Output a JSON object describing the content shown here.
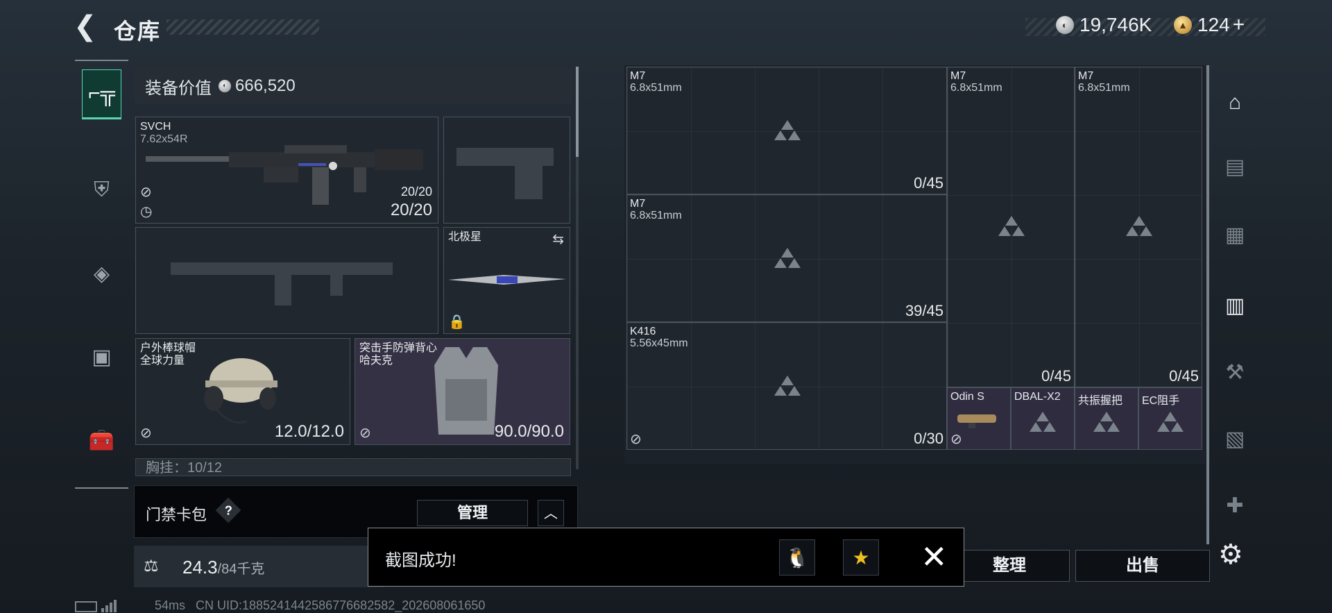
{
  "header": {
    "title": "仓库"
  },
  "currency": {
    "silver": "19,746K",
    "gold": "124"
  },
  "equipment_value": {
    "label": "装备价值",
    "value": "666,520"
  },
  "weapon_primary": {
    "name": "SVCH",
    "caliber": "7.62x54R",
    "mag": "20/20",
    "ammo": "20/20"
  },
  "melee": {
    "name": "北极星"
  },
  "helmet": {
    "name": "户外棒球帽",
    "sub": "全球力量",
    "durability": "12.0/12.0"
  },
  "armor": {
    "name": "突击手防弹背心",
    "sub": "哈夫克",
    "durability": "90.0/90.0"
  },
  "chest_rig": {
    "label": "胸挂：10/12"
  },
  "keycard": {
    "label": "门禁卡包",
    "help": "?",
    "manage": "管理"
  },
  "weight": {
    "value": "24.3",
    "max": "/84千克"
  },
  "status": {
    "ping": "54ms",
    "uid": "CN UID:1885241442586776682582_202608061650"
  },
  "magazines": [
    {
      "name": "M7",
      "caliber": "6.8x51mm",
      "count": "0/45"
    },
    {
      "name": "M7",
      "caliber": "6.8x51mm",
      "count": "39/45"
    },
    {
      "name": "K416",
      "caliber": "5.56x45mm",
      "count": "0/30"
    },
    {
      "name": "M7",
      "caliber": "6.8x51mm",
      "count": "0/45"
    },
    {
      "name": "M7",
      "caliber": "6.8x51mm",
      "count": "0/45"
    }
  ],
  "attachments": [
    {
      "name": "Odin S"
    },
    {
      "name": "DBAL-X2"
    },
    {
      "name": "共振握把"
    },
    {
      "name": "EC阻手"
    }
  ],
  "buttons": {
    "organize": "整理",
    "sell": "出售"
  },
  "toast": {
    "message": "截图成功!"
  },
  "right_nav": [
    "storage-icon",
    "tier-iii-rack-icon",
    "tier-iv-safe-icon",
    "tier-ii-rack-icon",
    "tier-iv-tool-icon",
    "tier-iv-cabinet-icon",
    "tier-iv-medical-icon"
  ]
}
